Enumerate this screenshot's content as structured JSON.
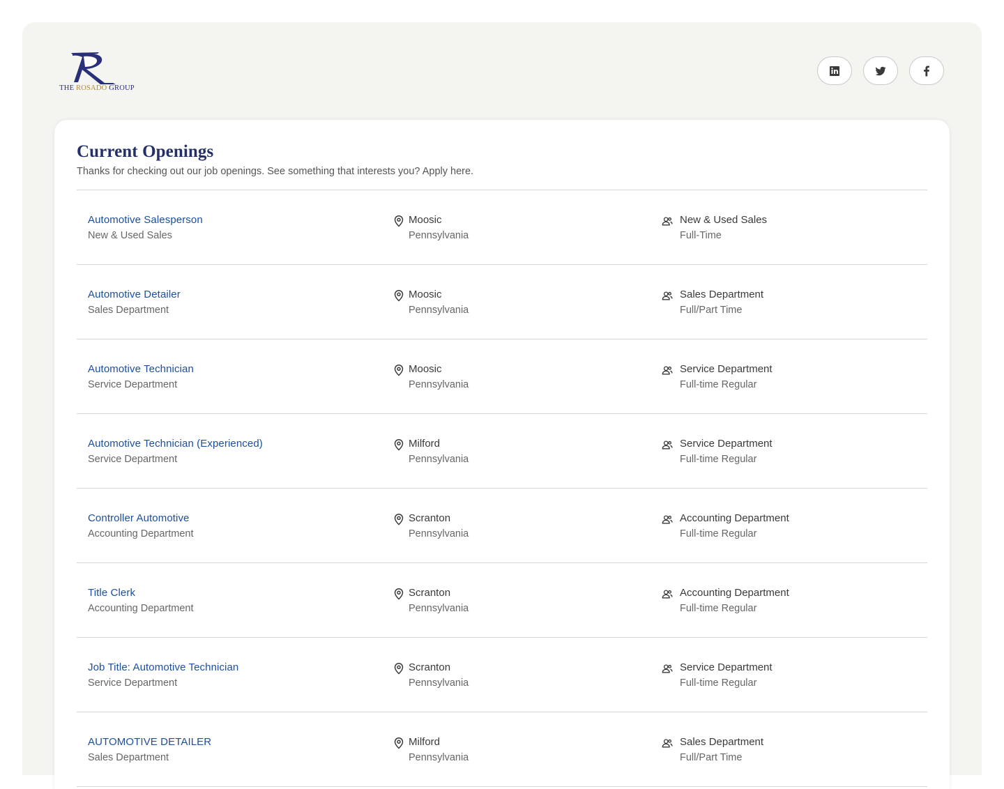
{
  "brand": {
    "logo_the": "THE",
    "logo_name": "ROSADO",
    "logo_group": "GROUP"
  },
  "social": [
    {
      "name": "linkedin",
      "icon": "linkedin-icon"
    },
    {
      "name": "twitter",
      "icon": "twitter-icon"
    },
    {
      "name": "facebook",
      "icon": "facebook-icon"
    }
  ],
  "header": {
    "title": "Current Openings",
    "subtitle": "Thanks for checking out our job openings. See something that interests you? Apply here."
  },
  "colors": {
    "title": "#25306b",
    "link": "#1c4fa0",
    "background": "#f4f4f1",
    "logo_gold": "#b08a3a"
  },
  "jobs": [
    {
      "title": "Automotive Salesperson",
      "department": "New & Used Sales",
      "city": "Moosic",
      "state": "Pennsylvania",
      "team": "New & Used Sales",
      "type": "Full-Time"
    },
    {
      "title": "Automotive Detailer",
      "department": "Sales Department",
      "city": "Moosic",
      "state": "Pennsylvania",
      "team": "Sales Department",
      "type": "Full/Part Time"
    },
    {
      "title": "Automotive Technician",
      "department": "Service Department",
      "city": "Moosic",
      "state": "Pennsylvania",
      "team": "Service Department",
      "type": "Full-time Regular"
    },
    {
      "title": "Automotive Technician (Experienced)",
      "department": "Service Department",
      "city": "Milford",
      "state": "Pennsylvania",
      "team": "Service Department",
      "type": "Full-time Regular"
    },
    {
      "title": "Controller Automotive",
      "department": "Accounting Department",
      "city": "Scranton",
      "state": "Pennsylvania",
      "team": "Accounting Department",
      "type": "Full-time Regular"
    },
    {
      "title": "Title Clerk",
      "department": "Accounting Department",
      "city": "Scranton",
      "state": "Pennsylvania",
      "team": "Accounting Department",
      "type": "Full-time Regular"
    },
    {
      "title": "Job Title: Automotive Technician",
      "department": "Service Department",
      "city": "Scranton",
      "state": "Pennsylvania",
      "team": "Service Department",
      "type": "Full-time Regular"
    },
    {
      "title": "AUTOMOTIVE DETAILER",
      "department": "Sales Department",
      "city": "Milford",
      "state": "Pennsylvania",
      "team": "Sales Department",
      "type": "Full/Part Time"
    }
  ]
}
